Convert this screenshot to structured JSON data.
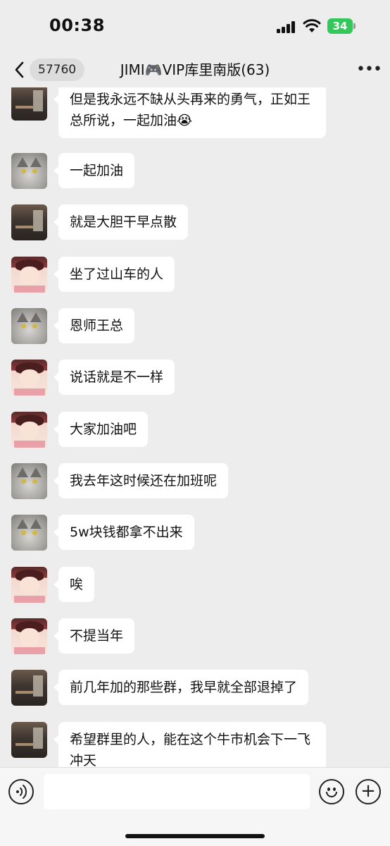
{
  "status": {
    "time": "00:38",
    "battery": "34"
  },
  "nav": {
    "badge": "57760",
    "title": "JIMI🎮VIP库里南版(63)",
    "more": "•••"
  },
  "messages": [
    {
      "avatar": "room",
      "text": "但是我永远不缺从头再来的勇气，正如王总所说，一起加油😭"
    },
    {
      "avatar": "cat",
      "text": "一起加油"
    },
    {
      "avatar": "room",
      "text": "就是大胆干早点散"
    },
    {
      "avatar": "anime",
      "text": "坐了过山车的人"
    },
    {
      "avatar": "cat",
      "text": "恩师王总"
    },
    {
      "avatar": "anime",
      "text": "说话就是不一样"
    },
    {
      "avatar": "anime",
      "text": "大家加油吧"
    },
    {
      "avatar": "cat",
      "text": "我去年这时候还在加班呢"
    },
    {
      "avatar": "cat",
      "text": "5w块钱都拿不出来"
    },
    {
      "avatar": "anime",
      "text": "唉"
    },
    {
      "avatar": "anime",
      "text": "不提当年"
    },
    {
      "avatar": "room",
      "text": "前几年加的那些群，我早就全部退掉了"
    },
    {
      "avatar": "room",
      "text": "希望群里的人，能在这个牛市机会下一飞冲天"
    }
  ],
  "input": {
    "icons": [
      "voice-icon",
      "emoji-icon",
      "plus-icon"
    ]
  }
}
